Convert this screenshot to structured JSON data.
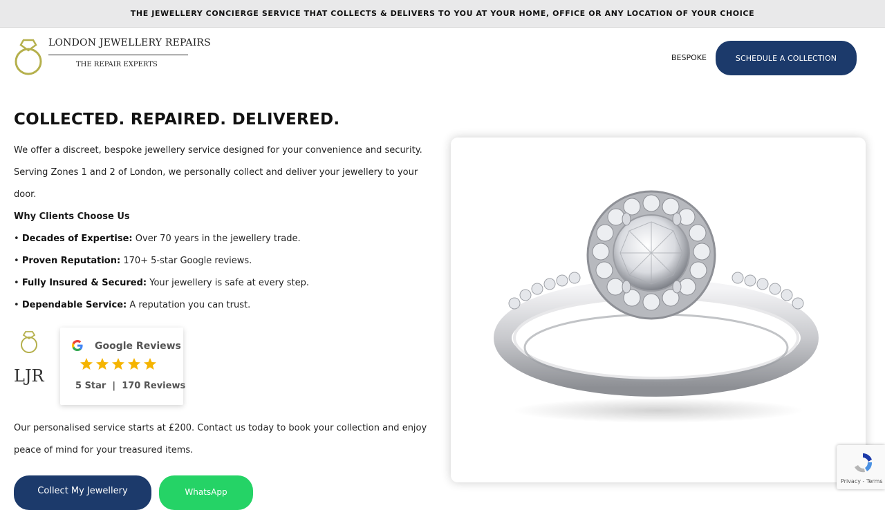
{
  "announcement": "THE JEWELLERY CONCIERGE SERVICE THAT COLLECTS & DELIVERS TO YOU AT YOUR HOME, OFFICE OR ANY LOCATION OF YOUR CHOICE",
  "header": {
    "brand_name": "LONDON JEWELLERY REPAIRS",
    "brand_tagline": "THE REPAIR EXPERTS",
    "nav_link": "BESPOKE",
    "cta_label": "SCHEDULE A COLLECTION"
  },
  "hero": {
    "title": "COLLECTED. REPAIRED. DELIVERED.",
    "intro": "We offer a discreet, bespoke jewellery service designed for your convenience and security. Serving Zones 1 and 2 of London, we personally collect and deliver your jewellery to your door.",
    "why_title": "Why Clients Choose Us",
    "bullets": [
      {
        "label": "Decades of Expertise:",
        "text": "Over 70 years in the jewellery trade."
      },
      {
        "label": "Proven Reputation:",
        "text": "170+ 5-star Google reviews."
      },
      {
        "label": "Fully Insured & Secured:",
        "text": "Your jewellery is safe at every step."
      },
      {
        "label": "Dependable Service:",
        "text": "A reputation you can trust."
      }
    ],
    "bullet_symbol": "•",
    "monogram": "LJR",
    "price_text": "Our personalised service starts at £200. Contact us today to book your collection and enjoy peace of mind for your treasured items.",
    "buttons": {
      "collect": "Collect My Jewellery",
      "whatsapp": "WhatsApp"
    }
  },
  "reviews": {
    "title": "Google Reviews",
    "stars": 5,
    "rating": "5 Star",
    "separator": "|",
    "count": "170 Reviews"
  },
  "recaptcha": {
    "text": "Privacy - Terms"
  },
  "colors": {
    "navy": "#1c3a6b",
    "whatsapp_green": "#25d366",
    "star": "#f5b400",
    "logo_gold": "#b5b04c"
  }
}
